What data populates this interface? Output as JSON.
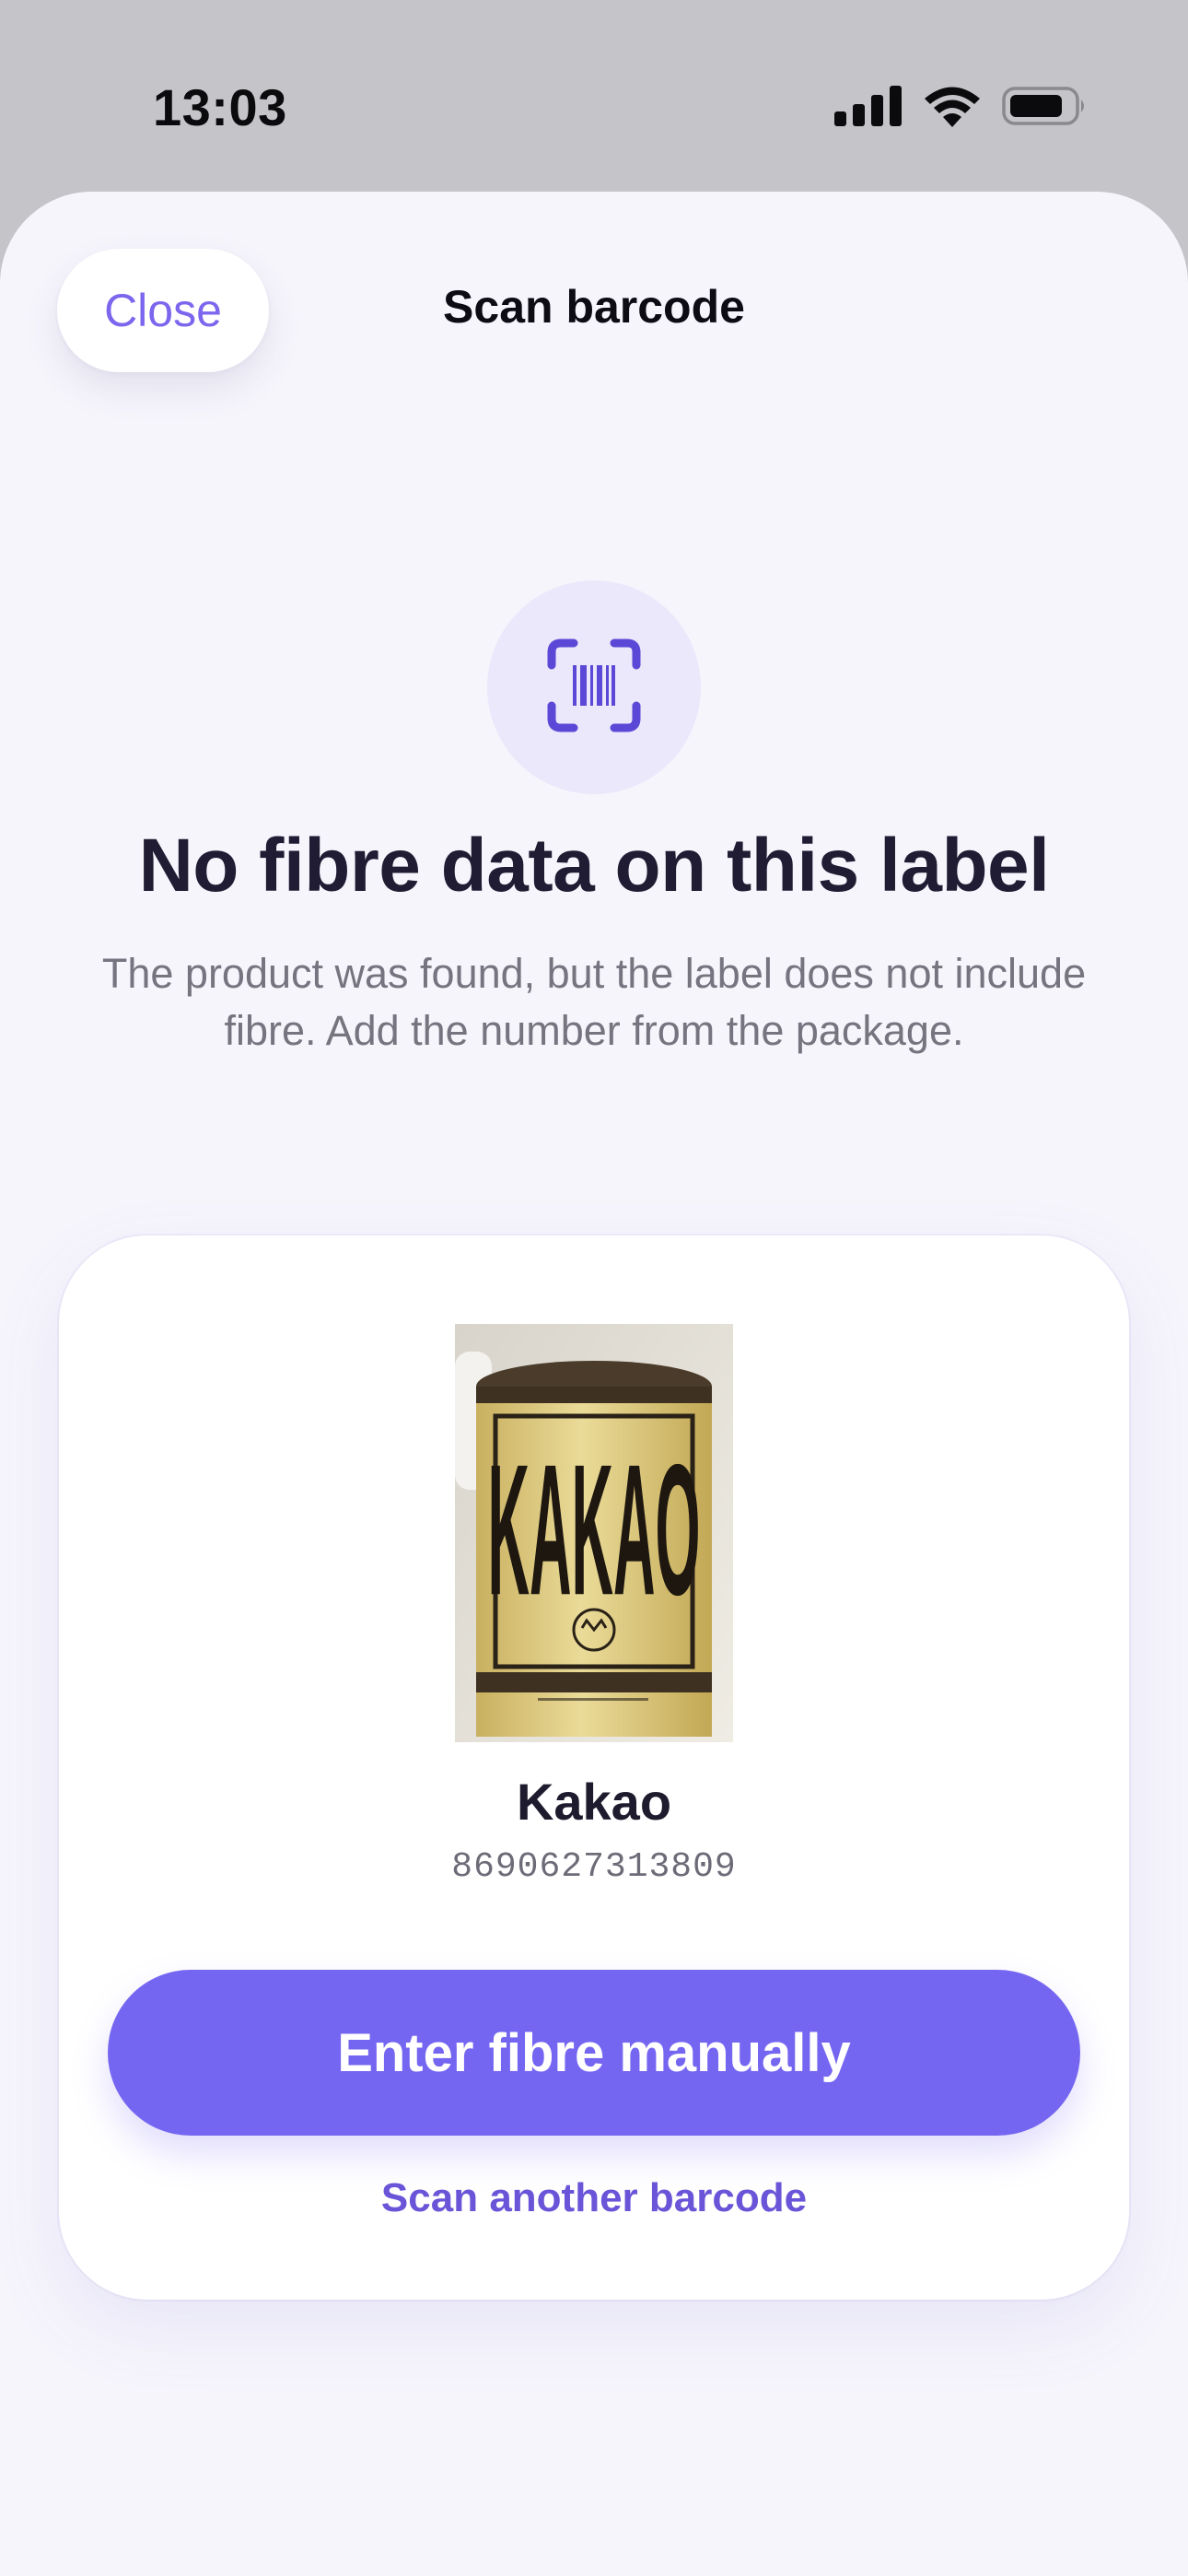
{
  "status_bar": {
    "time": "13:03",
    "icons": [
      "cellular-signal-icon",
      "wifi-icon",
      "battery-icon"
    ]
  },
  "header": {
    "close_label": "Close",
    "title": "Scan barcode"
  },
  "hero": {
    "icon": "barcode-scan-icon",
    "headline": "No fibre data on this label",
    "subtext": "The product was found, but the label does not include fibre. Add the number from the package."
  },
  "product": {
    "image_label": "KAKAO",
    "name": "Kakao",
    "barcode": "8690627313809"
  },
  "actions": {
    "primary_label": "Enter fibre manually",
    "secondary_label": "Scan another barcode"
  },
  "colors": {
    "accent": "#7566f1",
    "accent_text": "#6a55d8",
    "background": "#f6f5fc",
    "hero_circle": "#ebe8fb"
  }
}
